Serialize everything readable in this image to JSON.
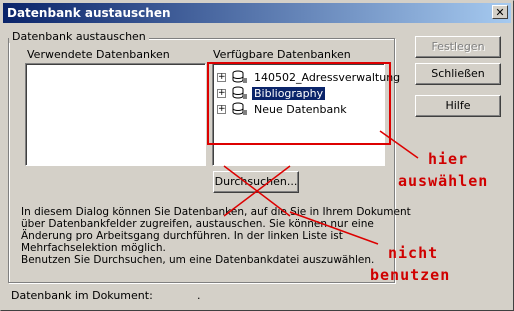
{
  "window": {
    "title": "Datenbank austauschen",
    "close_glyph": "✕"
  },
  "group": {
    "label": "Datenbank austauschen"
  },
  "used": {
    "label": "Verwendete Datenbanken"
  },
  "available": {
    "label": "Verfügbare Datenbanken",
    "items": [
      {
        "expander": "+",
        "label": "140502_Adressverwaltung",
        "selected": false
      },
      {
        "expander": "+",
        "label": "Bibliography",
        "selected": true
      },
      {
        "expander": "+",
        "label": "Neue Datenbank",
        "selected": false
      }
    ]
  },
  "buttons": {
    "define": "Festlegen",
    "close": "Schließen",
    "help": "Hilfe",
    "browse": "Durchsuchen..."
  },
  "description": [
    "In diesem Dialog können Sie Datenbanken, auf die Sie in Ihrem Dokument",
    "über Datenbankfelder zugreifen, austauschen. Sie können nur eine",
    "Änderung pro Arbeitsgang durchführen. In der linken Liste ist",
    "Mehrfachselektion möglich.",
    "Benutzen Sie Durchsuchen, um eine Datenbankdatei auszuwählen."
  ],
  "footer": {
    "label": "Datenbank im Dokument:",
    "value": "."
  },
  "annotations": {
    "select_here_1": "hier",
    "select_here_2": "auswählen",
    "not_use_1": "nicht",
    "not_use_2": "benutzen",
    "color": "#dd0000"
  }
}
